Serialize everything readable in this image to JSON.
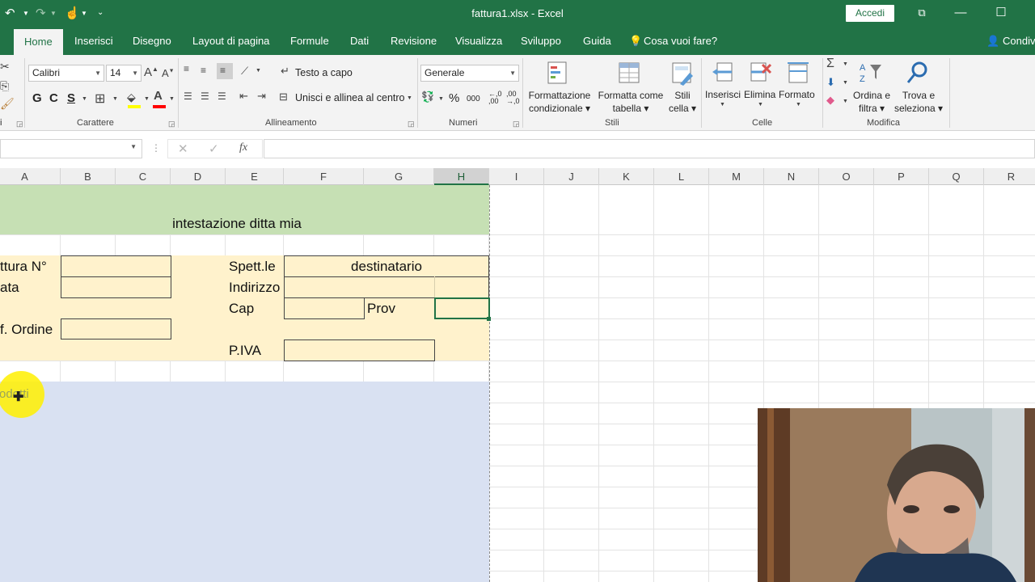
{
  "window": {
    "title": "fattura1.xlsx  -  Excel",
    "signin": "Accedi"
  },
  "tabs": [
    "Home",
    "Inserisci",
    "Disegno",
    "Layout di pagina",
    "Formule",
    "Dati",
    "Revisione",
    "Visualizza",
    "Sviluppo",
    "Guida",
    "Cosa vuoi fare?",
    "Condivi"
  ],
  "ribbon": {
    "font_name": "Calibri",
    "font_size": "14",
    "bold": "G",
    "italic": "C",
    "underline": "S",
    "group_font": "Carattere",
    "wrap_text": "Testo a capo",
    "merge_center": "Unisci e allinea al centro",
    "group_align": "Allineamento",
    "number_format": "Generale",
    "percent": "%",
    "thousands": "000",
    "group_number": "Numeri",
    "cond_format_1": "Formattazione",
    "cond_format_2": "condizionale",
    "format_table_1": "Formatta come",
    "format_table_2": "tabella",
    "cell_styles_1": "Stili",
    "cell_styles_2": "cella",
    "group_styles": "Stili",
    "insert": "Inserisci",
    "delete": "Elimina",
    "format": "Formato",
    "group_cells": "Celle",
    "sort_1": "Ordina e",
    "sort_2": "filtra",
    "find_1": "Trova e",
    "find_2": "seleziona",
    "group_edit": "Modifica",
    "clipboard_frag": "i",
    "fx": "fx"
  },
  "columns": [
    "A",
    "B",
    "C",
    "D",
    "E",
    "F",
    "G",
    "H",
    "I",
    "J",
    "K",
    "L",
    "M",
    "N",
    "O",
    "P",
    "Q",
    "R"
  ],
  "selected_column": "H",
  "cells": {
    "header_title": "intestazione ditta mia",
    "invoice_no": "ttura N°",
    "date": "ata",
    "order_ref": "f. Ordine",
    "spett": "Spett.le",
    "recipient": "destinatario",
    "address": "Indirizzo",
    "cap": "Cap",
    "prov": "Prov",
    "piva": "P.IVA",
    "products": "rodotti"
  },
  "colors": {
    "excel_green": "#217346",
    "header_fill": "#c6e0b4",
    "customer_fill": "#fff2cc",
    "products_fill": "#d9e1f2"
  }
}
